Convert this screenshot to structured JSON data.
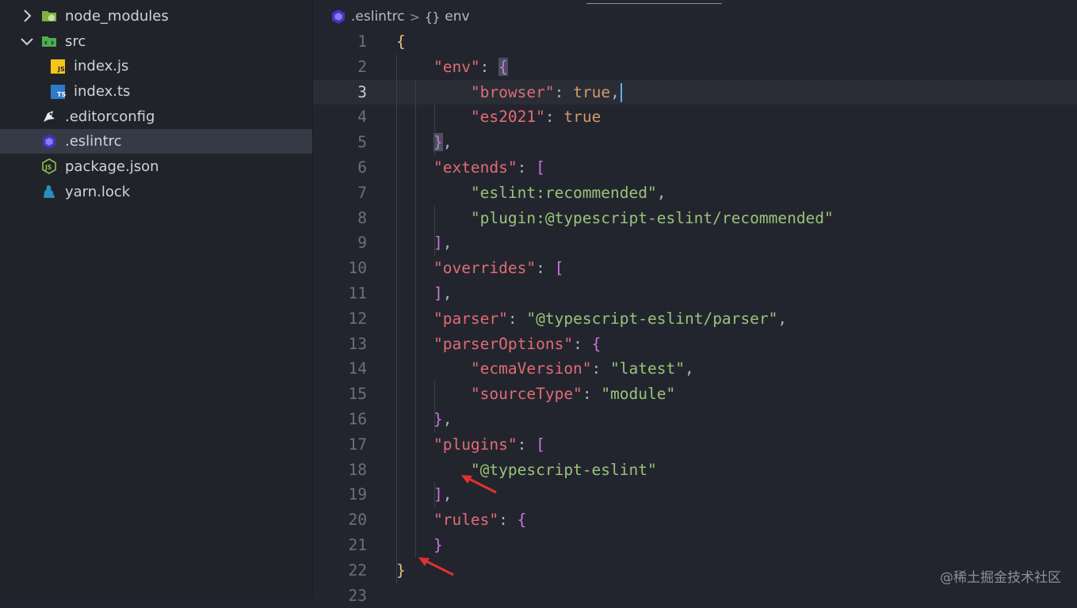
{
  "sidebar": {
    "items": [
      {
        "label": "node_modules",
        "icon": "folder-node-icon",
        "twisty": "chevron-right-icon"
      },
      {
        "label": "src",
        "icon": "folder-src-icon",
        "twisty": "chevron-down-icon"
      },
      {
        "label": "index.js",
        "icon": "js-file-icon"
      },
      {
        "label": "index.ts",
        "icon": "ts-file-icon"
      },
      {
        "label": ".editorconfig",
        "icon": "editorconfig-icon"
      },
      {
        "label": ".eslintrc",
        "icon": "eslint-icon",
        "selected": true
      },
      {
        "label": "package.json",
        "icon": "nodejs-icon"
      },
      {
        "label": "yarn.lock",
        "icon": "yarn-icon"
      }
    ]
  },
  "breadcrumb": {
    "file": ".eslintrc",
    "separator": ">",
    "symbol_braces": "{}",
    "symbol": "env"
  },
  "editor": {
    "current_line": 3,
    "line_numbers": [
      "1",
      "2",
      "3",
      "4",
      "5",
      "6",
      "7",
      "8",
      "9",
      "10",
      "11",
      "12",
      "13",
      "14",
      "15",
      "16",
      "17",
      "18",
      "19",
      "20",
      "21",
      "22",
      "23"
    ],
    "lines": [
      "{",
      "    \"env\": {",
      "        \"browser\": true,",
      "        \"es2021\": true",
      "    },",
      "    \"extends\": [",
      "        \"eslint:recommended\",",
      "        \"plugin:@typescript-eslint/recommended\"",
      "    ],",
      "    \"overrides\": [",
      "    ],",
      "    \"parser\": \"@typescript-eslint/parser\",",
      "    \"parserOptions\": {",
      "        \"ecmaVersion\": \"latest\",",
      "        \"sourceType\": \"module\"",
      "    },",
      "    \"plugins\": [",
      "        \"@typescript-eslint\"",
      "    ],",
      "    \"rules\": {",
      "    }",
      "}",
      ""
    ]
  },
  "colors": {
    "key": "#e06c75",
    "string": "#98c379",
    "bracket_level1": "#e5c07b",
    "bracket_level2": "#c678dd",
    "cursor": "#61afef",
    "annotation_arrow": "#e0312f"
  },
  "watermark": "@稀土掘金技术社区"
}
